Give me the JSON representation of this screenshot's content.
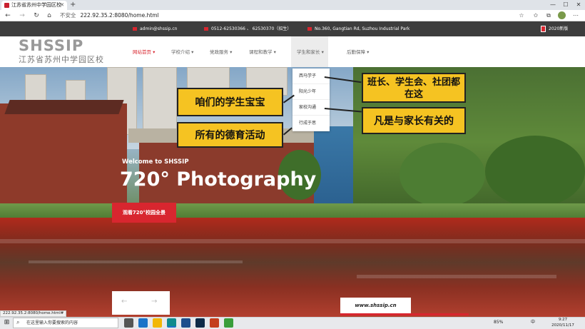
{
  "browser": {
    "tab_title": "江苏省苏州中学园区校",
    "new_tab_symbol": "+",
    "window_controls": {
      "minimize": "—",
      "maximize": "☐",
      "close": "✕"
    },
    "nav": {
      "back": "←",
      "forward": "→",
      "reload": "↻",
      "home": "⌂"
    },
    "security_warning": "不安全",
    "url": "222.92.35.2:8080/home.html",
    "status_url": "222.92.35.2:8080/home.html#"
  },
  "topbar": {
    "email": "admin@shssip.cn",
    "phone": "0512-62530366 、 62530370（招生）",
    "address": "No.360, Gangtian Rd, Suzhou Industrial Park",
    "year_label": "2020新版"
  },
  "logo": {
    "wordmark": "SHSSIP",
    "name_cn": "江苏省苏州中学园区校"
  },
  "nav": {
    "items": [
      {
        "label": "网站首页 ▾"
      },
      {
        "label": "学校介绍 ▾"
      },
      {
        "label": "党政服务 ▾"
      },
      {
        "label": "课程和教学 ▾"
      },
      {
        "label": "学生和家长 ▾"
      },
      {
        "label": "后勤保障 ▾"
      }
    ]
  },
  "dropdown": {
    "items": [
      {
        "label": "西马学子"
      },
      {
        "label": "阳光少年"
      },
      {
        "label": "家校沟通"
      },
      {
        "label": "行成于思"
      }
    ]
  },
  "hero": {
    "welcome": "Welcome to SHSSIP",
    "title": "720° Photography",
    "view_button": "观看720°校园全景",
    "prev_arrow": "←",
    "next_arrow": "→",
    "site_link": "www.shssip.cn"
  },
  "annotations": {
    "note1": "咱们的学生宝宝",
    "note2": "所有的德育活动",
    "note3": "班长、学生会、社团都在这",
    "note4": "凡是与家长有关的"
  },
  "taskbar": {
    "search_placeholder": "在这里输入你要搜索的内容",
    "tray_battery": "85%",
    "tray_lang": "中",
    "time": "9:27",
    "date": "2020/11/17"
  },
  "colors": {
    "accent": "#d8262f",
    "topbar_bg": "#3d3d3d",
    "note_bg": "#f5c322"
  }
}
